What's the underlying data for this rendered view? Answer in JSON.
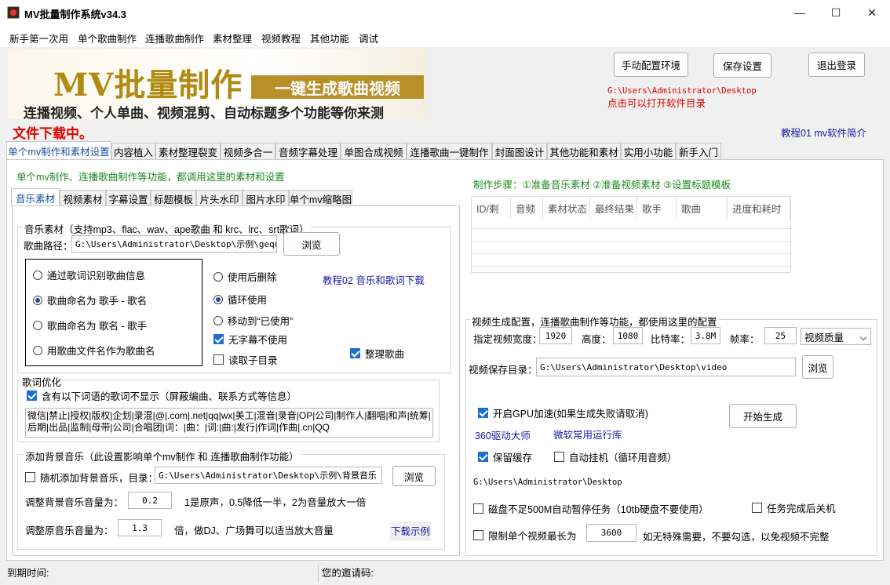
{
  "window": {
    "title": "MV批量制作系统v34.3",
    "min": "—",
    "max": "☐",
    "close": "✕"
  },
  "menu": [
    "新手第一次用",
    "单个歌曲制作",
    "连播歌曲制作",
    "素材整理",
    "视频教程",
    "其他功能",
    "调试"
  ],
  "banner": {
    "big": "MV批量制作",
    "strip": "一键生成歌曲视频",
    "sub": "连播视频、个人单曲、视频混剪、自动标题多个功能等你来测"
  },
  "download_status": "文件下载中。",
  "top_buttons": {
    "config_env": "手动配置环境",
    "save_settings": "保存设置",
    "logout": "退出登录"
  },
  "app_path": "G:\\Users\\Administrator\\Desktop",
  "app_path_hint": "点击可以打开软件目录",
  "tutorial01": "教程01 mv软件简介",
  "main_tabs": [
    "单个mv制作和素材设置",
    "内容植入",
    "素材整理裂变",
    "视频多合一",
    "音频字幕处理",
    "单图合成视频",
    "连播歌曲一键制作",
    "封面图设计",
    "其他功能和素材",
    "实用小功能",
    "新手入门"
  ],
  "section_intro": "单个mv制作、连播歌曲制作等功能，都调用这里的素材和设置",
  "sub_tabs": [
    "音乐素材",
    "视频素材",
    "字幕设置",
    "标题模板",
    "片头水印",
    "图片水印",
    "单个mv缩略图"
  ],
  "music": {
    "group_label": "音乐素材（支持mp3、flac、wav、ape歌曲 和 krc、lrc、srt歌词）",
    "path_label": "歌曲路径：",
    "path_value": "G:\\Users\\Administrator\\Desktop\\示例\\gequ",
    "browse": "浏览",
    "radios": [
      "通过歌词识别歌曲信息",
      "歌曲命名为   歌手 - 歌名",
      "歌曲命名为   歌名 - 歌手",
      "用歌曲文件名作为歌曲名"
    ],
    "radio_selected": 1,
    "after_use": [
      "使用后删除",
      "循环使用",
      "移动到“已使用”"
    ],
    "after_selected": 1,
    "no_subtitle": "无字幕不使用",
    "read_subdir": "读取子目录",
    "organize": "整理歌曲",
    "tutorial02": "教程02 音乐和歌词下载"
  },
  "lyrics": {
    "group_label": "歌词优化",
    "hide_label": "含有以下词语的歌词不显示（屏蔽编曲、联系方式等信息）",
    "words": "微信|禁止|授权|版权|企划|录混|@|.com|.net|qq|wx|美工|混音|录音|OP|公司|制作人|翻唱|和声|统筹|后期|出品|监制|母带|公司|合唱团|词：|曲：|词:|曲:|发行|作词|作曲|.cn|QQ"
  },
  "bgm": {
    "group_label": "添加背景音乐（此设置影响单个mv制作 和 连播歌曲制作功能）",
    "random_label": "随机添加背景音乐，目录：",
    "path_value": "G:\\Users\\Administrator\\Desktop\\示例\\背景音乐",
    "browse": "浏览",
    "bg_vol_label": "调整背景音乐音量为：",
    "bg_vol_value": "0.2",
    "bg_vol_hint": "1是原声，0.5降低一半，2为音量放大一倍",
    "orig_vol_label": "调整原音乐音量为：",
    "orig_vol_value": "1.3",
    "orig_vol_hint": "倍，做DJ、广场舞可以适当放大音量",
    "download_example": "下载示例"
  },
  "steps": "制作步骤：①准备音乐素材 ②准备视频素材  ③设置标题模板",
  "grid_headers": [
    "ID/剩",
    "音频",
    "素材状态",
    "最终结果",
    "歌手",
    "歌曲",
    "进度和耗时"
  ],
  "video": {
    "group_label": "视频生成配置，连播歌曲制作等功能，都使用这里的配置",
    "width_label": "指定视频宽度：",
    "width_value": "1920",
    "height_label": "高度：",
    "height_value": "1080",
    "bitrate_label": "比特率：",
    "bitrate_value": "3.8M",
    "fps_label": "帧率：",
    "fps_value": "25",
    "quality": "视频质量",
    "save_label": "视频保存目录：",
    "save_value": "G:\\Users\\Administrator\\Desktop\\video",
    "browse": "浏览",
    "gpu": "开启GPU加速(如果生成失败请取消)",
    "start": "开始生成",
    "driver_link": "360驱动大师",
    "runtime_link": "微软常用运行库",
    "keep_cache": "保留缓存",
    "auto_hang": "自动挂机（循环用音频）",
    "desktop_path": "G:\\Users\\Administrator\\Desktop",
    "disk_pause": "磁盘不足500M自动暂停任务（10tb硬盘不要使用）",
    "shutdown": "任务完成后关机",
    "limit_label": "限制单个视频最长为",
    "limit_value": "3600",
    "limit_hint": "如无特殊需要，不要勾选，以免视频不完整"
  },
  "status": {
    "expiry": "到期时间:",
    "invite": "您的邀请码:"
  }
}
